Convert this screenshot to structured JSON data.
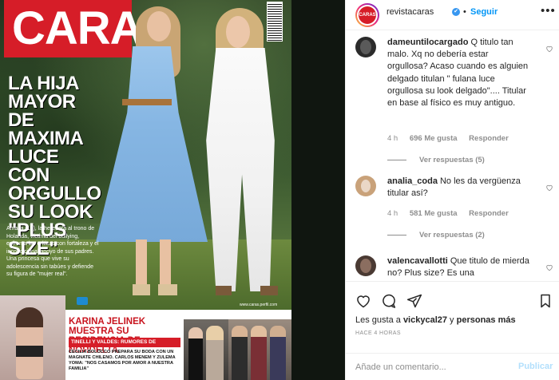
{
  "cover": {
    "logo": "CARAS",
    "headline": "LA HIJA MAYOR DE MAXIMA LUCE CON ORGULLO SU LOOK \"PLUS SIZE\"",
    "subcopy": "Amalia (16), la heredera al trono de Holanda, víctima del bullying, enfrenta las críticas con fortaleza y el incondicional apoyo de sus padres. Una princesa que vive su adolescencia sin tabúes y defiende su figura de \"mujer real\".",
    "website": "www.caras.perfil.com",
    "story_title": "KARINA JELINEK MUESTRA SU RESIDENCIA DE NORDELTA",
    "story_bar": "TINELLI Y VALDES: RUMORES DE RECONCILIACIÓN",
    "story_sub": "CECILIA BOLOCCO PREPARA SU BODA CON UN MAGNATE CHILENO. CARLOS MENEM Y ZULEMA YOMA: \"NOS CASAMOS POR AMOR A NUESTRA FAMILIA\""
  },
  "header": {
    "avatar_text": "CARAS",
    "username": "revistacaras",
    "verified_icon": "✔",
    "separator": "•",
    "follow_label": "Seguir",
    "more_label": "•••"
  },
  "comments": [
    {
      "user": "dameuntilocargado",
      "text": "Q titulo tan malo. Xq no debería estar orgullosa? Acaso cuando es alguien delgado titulan \" fulana luce orgullosa su look delgado\".... Titular en base al físico es muy antiguo.",
      "time": "4 h",
      "likes": "696 Me gusta",
      "reply": "Responder",
      "view_replies": "Ver respuestas (5)",
      "avatar_color": "#2b2b2b"
    },
    {
      "user": "analia_coda",
      "text": "No les da vergüenza titular así?",
      "time": "4 h",
      "likes": "581 Me gusta",
      "reply": "Responder",
      "view_replies": "Ver respuestas (2)",
      "avatar_color": "#c9a27a"
    },
    {
      "user": "valencavallotti",
      "text": "Que titulo de mierda no? Plus size? Es una",
      "avatar_color": "#4a3a33"
    }
  ],
  "actions": {
    "likes_prefix": "Les gusta a ",
    "likes_user": "vickycal27",
    "likes_middle": " y ",
    "likes_others": "personas más",
    "time_ago": "HACE 4 HORAS"
  },
  "add_comment": {
    "placeholder": "Añade un comentario...",
    "publish_label": "Publicar"
  },
  "colors": {
    "brand_red": "#d61d28",
    "link_blue": "#0095f6",
    "publish_disabled": "#b2dffc",
    "muted": "#8e8e8e"
  }
}
